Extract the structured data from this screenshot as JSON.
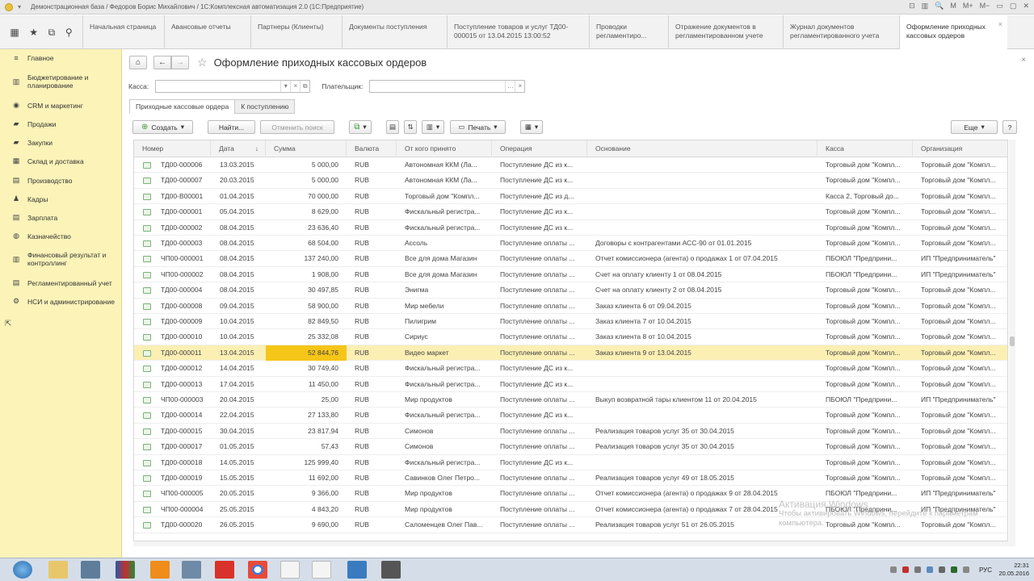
{
  "window": {
    "title": "Демонстрационная база / Федоров Борис Михайлович / 1С:Комплексная автоматизация 2.0 (1С:Предприятие)",
    "controls": [
      "⊡",
      "▥",
      "🔍",
      "M",
      "M+",
      "M−",
      "▭",
      "▢",
      "✕"
    ]
  },
  "quick_icons": [
    "apps-icon",
    "star-icon",
    "history-icon",
    "search-icon"
  ],
  "tabs": [
    {
      "label": "Начальная страница"
    },
    {
      "label": "Авансовые отчеты"
    },
    {
      "label": "Партнеры (Клиенты)"
    },
    {
      "label": "Документы поступления"
    },
    {
      "label": "Поступление товаров и услуг ТД00-000015 от 13.04.2015 13:00:52"
    },
    {
      "label": "Проводки регламентиро..."
    },
    {
      "label": "Отражение документов в регламентированном учете"
    },
    {
      "label": "Журнал документов регламентированного учета"
    },
    {
      "label": "Оформление приходных кассовых ордеров"
    }
  ],
  "sidebar": {
    "items": [
      {
        "label": "Главное",
        "icon": "≡"
      },
      {
        "label": "Бюджетирование и планирование",
        "icon": "▥"
      },
      {
        "label": "CRM и маркетинг",
        "icon": "◉"
      },
      {
        "label": "Продажи",
        "icon": "▰"
      },
      {
        "label": "Закупки",
        "icon": "▰"
      },
      {
        "label": "Склад и доставка",
        "icon": "▦"
      },
      {
        "label": "Производство",
        "icon": "▤"
      },
      {
        "label": "Кадры",
        "icon": "♟"
      },
      {
        "label": "Зарплата",
        "icon": "▤"
      },
      {
        "label": "Казначейство",
        "icon": "◍"
      },
      {
        "label": "Финансовый результат и контроллинг",
        "icon": "▥"
      },
      {
        "label": "Регламентированный учет",
        "icon": "▤"
      },
      {
        "label": "НСИ и администрирование",
        "icon": "⚙"
      }
    ]
  },
  "page": {
    "title": "Оформление приходных кассовых ордеров",
    "back": "←",
    "forward": "→",
    "home": "⌂",
    "star": "☆",
    "close": "×"
  },
  "filters": {
    "kassa_label": "Касса:",
    "kassa_value": "",
    "payer_label": "Плательщик:",
    "payer_value": ""
  },
  "subtabs": [
    {
      "label": "Приходные кассовые ордера"
    },
    {
      "label": "К поступлению"
    }
  ],
  "toolbar": {
    "create": "Создать",
    "find": "Найти...",
    "cancel_search": "Отменить поиск",
    "print": "Печать",
    "more": "Еще",
    "help": "?"
  },
  "table": {
    "columns": [
      "Номер",
      "Дата",
      "Сумма",
      "Валюта",
      "От кого принято",
      "Операция",
      "Основание",
      "Касса",
      "Организация"
    ],
    "sort_indicator": "↓",
    "rows": [
      [
        "ТД00-000006",
        "13.03.2015",
        "5 000,00",
        "RUB",
        "Автономная ККМ (Ла...",
        "Поступление ДС из к...",
        "",
        "Торговый дом \"Компл...",
        "Торговый дом \"Компл..."
      ],
      [
        "ТД00-000007",
        "20.03.2015",
        "5 000,00",
        "RUB",
        "Автономная ККМ (Ла...",
        "Поступление ДС из к...",
        "",
        "Торговый дом \"Компл...",
        "Торговый дом \"Компл..."
      ],
      [
        "ТД00-В00001",
        "01.04.2015",
        "70 000,00",
        "RUB",
        "Торговый дом \"Компл...",
        "Поступление ДС из д...",
        "",
        "Касса 2, Торговый до...",
        "Торговый дом \"Компл..."
      ],
      [
        "ТД00-000001",
        "05.04.2015",
        "8 629,00",
        "RUB",
        "Фискальный регистра...",
        "Поступление ДС из к...",
        "",
        "Торговый дом \"Компл...",
        "Торговый дом \"Компл..."
      ],
      [
        "ТД00-000002",
        "08.04.2015",
        "23 636,40",
        "RUB",
        "Фискальный регистра...",
        "Поступление ДС из к...",
        "",
        "Торговый дом \"Компл...",
        "Торговый дом \"Компл..."
      ],
      [
        "ТД00-000003",
        "08.04.2015",
        "68 504,00",
        "RUB",
        "Ассоль",
        "Поступление оплаты ...",
        "Договоры с контрагентами АСС-90 от 01.01.2015",
        "Торговый дом \"Компл...",
        "Торговый дом \"Компл..."
      ],
      [
        "ЧП00-000001",
        "08.04.2015",
        "137 240,00",
        "RUB",
        "Все для дома Магазин",
        "Поступление оплаты ...",
        "Отчет комиссионера (агента) о продажах 1 от 07.04.2015",
        "ПБОЮЛ \"Предприни...",
        "ИП \"Предприниматель\""
      ],
      [
        "ЧП00-000002",
        "08.04.2015",
        "1 908,00",
        "RUB",
        "Все для дома Магазин",
        "Поступление оплаты ...",
        "Счет на оплату клиенту 1 от 08.04.2015",
        "ПБОЮЛ \"Предприни...",
        "ИП \"Предприниматель\""
      ],
      [
        "ТД00-000004",
        "08.04.2015",
        "30 497,85",
        "RUB",
        "Энигма",
        "Поступление оплаты ...",
        "Счет на оплату клиенту 2 от 08.04.2015",
        "Торговый дом \"Компл...",
        "Торговый дом \"Компл..."
      ],
      [
        "ТД00-000008",
        "09.04.2015",
        "58 900,00",
        "RUB",
        "Мир мебели",
        "Поступление оплаты ...",
        "Заказ клиента 6 от 09.04.2015",
        "Торговый дом \"Компл...",
        "Торговый дом \"Компл..."
      ],
      [
        "ТД00-000009",
        "10.04.2015",
        "82 849,50",
        "RUB",
        "Пилигрим",
        "Поступление оплаты ...",
        "Заказ клиента 7 от 10.04.2015",
        "Торговый дом \"Компл...",
        "Торговый дом \"Компл..."
      ],
      [
        "ТД00-000010",
        "10.04.2015",
        "25 332,08",
        "RUB",
        "Сириус",
        "Поступление оплаты ...",
        "Заказ клиента 8 от 10.04.2015",
        "Торговый дом \"Компл...",
        "Торговый дом \"Компл..."
      ],
      [
        "ТД00-000011",
        "13.04.2015",
        "52 844,76",
        "RUB",
        "Видео маркет",
        "Поступление оплаты ...",
        "Заказ клиента 9 от 13.04.2015",
        "Торговый дом \"Компл...",
        "Торговый дом \"Компл..."
      ],
      [
        "ТД00-000012",
        "14.04.2015",
        "30 749,40",
        "RUB",
        "Фискальный регистра...",
        "Поступление ДС из к...",
        "",
        "Торговый дом \"Компл...",
        "Торговый дом \"Компл..."
      ],
      [
        "ТД00-000013",
        "17.04.2015",
        "11 450,00",
        "RUB",
        "Фискальный регистра...",
        "Поступление ДС из к...",
        "",
        "Торговый дом \"Компл...",
        "Торговый дом \"Компл..."
      ],
      [
        "ЧП00-000003",
        "20.04.2015",
        "25,00",
        "RUB",
        "Мир продуктов",
        "Поступление оплаты ...",
        "Выкуп возвратной тары клиентом 11 от 20.04.2015",
        "ПБОЮЛ \"Предприни...",
        "ИП \"Предприниматель\""
      ],
      [
        "ТД00-000014",
        "22.04.2015",
        "27 133,80",
        "RUB",
        "Фискальный регистра...",
        "Поступление ДС из к...",
        "",
        "Торговый дом \"Компл...",
        "Торговый дом \"Компл..."
      ],
      [
        "ТД00-000015",
        "30.04.2015",
        "23 817,94",
        "RUB",
        "Симонов",
        "Поступление оплаты ...",
        "Реализация товаров услуг 35 от 30.04.2015",
        "Торговый дом \"Компл...",
        "Торговый дом \"Компл..."
      ],
      [
        "ТД00-000017",
        "01.05.2015",
        "57,43",
        "RUB",
        "Симонов",
        "Поступление оплаты ...",
        "Реализация товаров услуг 35 от 30.04.2015",
        "Торговый дом \"Компл...",
        "Торговый дом \"Компл..."
      ],
      [
        "ТД00-000018",
        "14.05.2015",
        "125 999,40",
        "RUB",
        "Фискальный регистра...",
        "Поступление ДС из к...",
        "",
        "Торговый дом \"Компл...",
        "Торговый дом \"Компл..."
      ],
      [
        "ТД00-000019",
        "15.05.2015",
        "11 692,00",
        "RUB",
        "Савинков Олег Петро...",
        "Поступление оплаты ...",
        "Реализация товаров услуг 49 от 18.05.2015",
        "Торговый дом \"Компл...",
        "Торговый дом \"Компл..."
      ],
      [
        "ЧП00-000005",
        "20.05.2015",
        "9 366,00",
        "RUB",
        "Мир продуктов",
        "Поступление оплаты ...",
        "Отчет комиссионера (агента) о продажах 9 от 28.04.2015",
        "ПБОЮЛ \"Предприни...",
        "ИП \"Предприниматель\""
      ],
      [
        "ЧП00-000004",
        "25.05.2015",
        "4 843,20",
        "RUB",
        "Мир продуктов",
        "Поступление оплаты ...",
        "Отчет комиссионера (агента) о продажах 7 от 28.04.2015",
        "ПБОЮЛ \"Предприни...",
        "ИП \"Предприниматель\""
      ],
      [
        "ТД00-000020",
        "26.05.2015",
        "9 690,00",
        "RUB",
        "Саломенцев Олег Пав...",
        "Поступление оплаты ...",
        "Реализация товаров услуг 51 от 26.05.2015",
        "Торговый дом \"Компл...",
        "Торговый дом \"Компл..."
      ]
    ],
    "selected_row": 12
  },
  "watermark": {
    "line1": "Активация Windows",
    "line2": "Чтобы активировать Windows, перейдите к параметрам",
    "line3": "компьютера."
  },
  "taskbar": {
    "lang": "РУС",
    "time": "22:31",
    "date": "20.05.2016"
  },
  "colors": {
    "sidebar_bg": "#fbf3b8",
    "selected_row": "#fbefb3",
    "selected_cell": "#f5c518"
  }
}
